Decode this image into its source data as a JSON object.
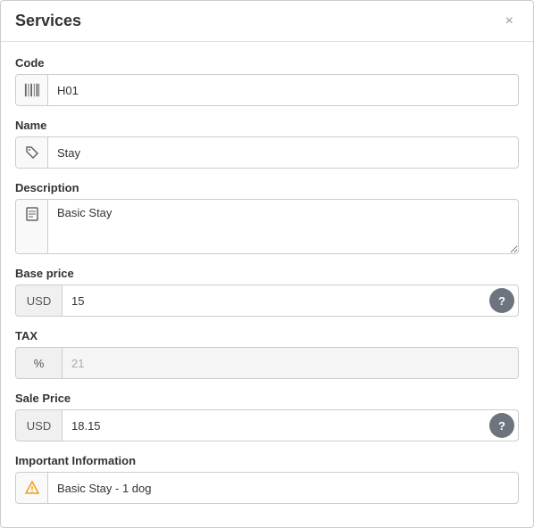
{
  "modal": {
    "title": "Services",
    "close_label": "×"
  },
  "fields": {
    "code": {
      "label": "Code",
      "value": "H01",
      "placeholder": "",
      "icon": "barcode"
    },
    "name": {
      "label": "Name",
      "value": "Stay",
      "placeholder": "",
      "icon": "tag"
    },
    "description": {
      "label": "Description",
      "value": "Basic Stay",
      "placeholder": "",
      "icon": "document"
    },
    "base_price": {
      "label": "Base price",
      "currency": "USD",
      "value": "15"
    },
    "tax": {
      "label": "TAX",
      "prefix": "%",
      "value": "21",
      "disabled": true
    },
    "sale_price": {
      "label": "Sale Price",
      "currency": "USD",
      "value": "18.15"
    },
    "important_info": {
      "label": "Important Information",
      "value": "Basic Stay - 1 dog"
    }
  }
}
